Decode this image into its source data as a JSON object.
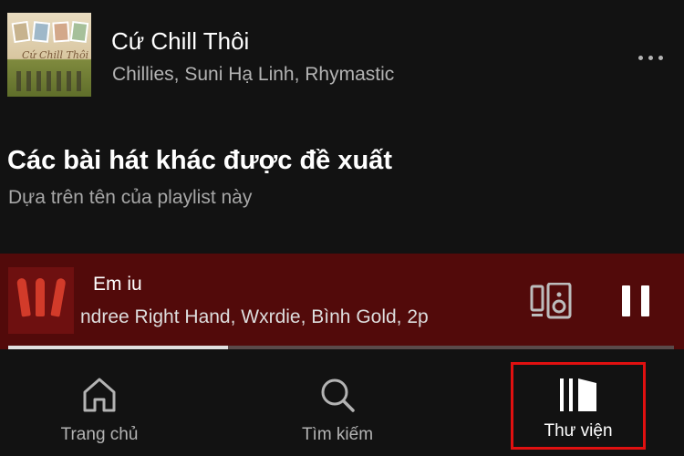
{
  "track": {
    "title": "Cứ Chill Thôi",
    "artists": "Chillies, Suni Hạ Linh, Rhymastic",
    "cover_icon": "album-cover",
    "cover_script": "Cứ Chill Thôi",
    "more_icon": "more-dots-icon"
  },
  "recommended": {
    "title": "Các bài hát khác được đề xuất",
    "subtitle": "Dựa trên tên của playlist này"
  },
  "now_playing": {
    "title": "Em iu",
    "artists": "ndree Right Hand, Wxrdie, Bình Gold, 2p",
    "progress": 0.33,
    "device_icon": "connect-device-icon",
    "pause_icon": "pause-icon",
    "background_color": "#520a0a"
  },
  "nav": {
    "home_label": "Trang chủ",
    "search_label": "Tìm kiếm",
    "library_label": "Thư viện",
    "highlight_color": "#e01010"
  }
}
